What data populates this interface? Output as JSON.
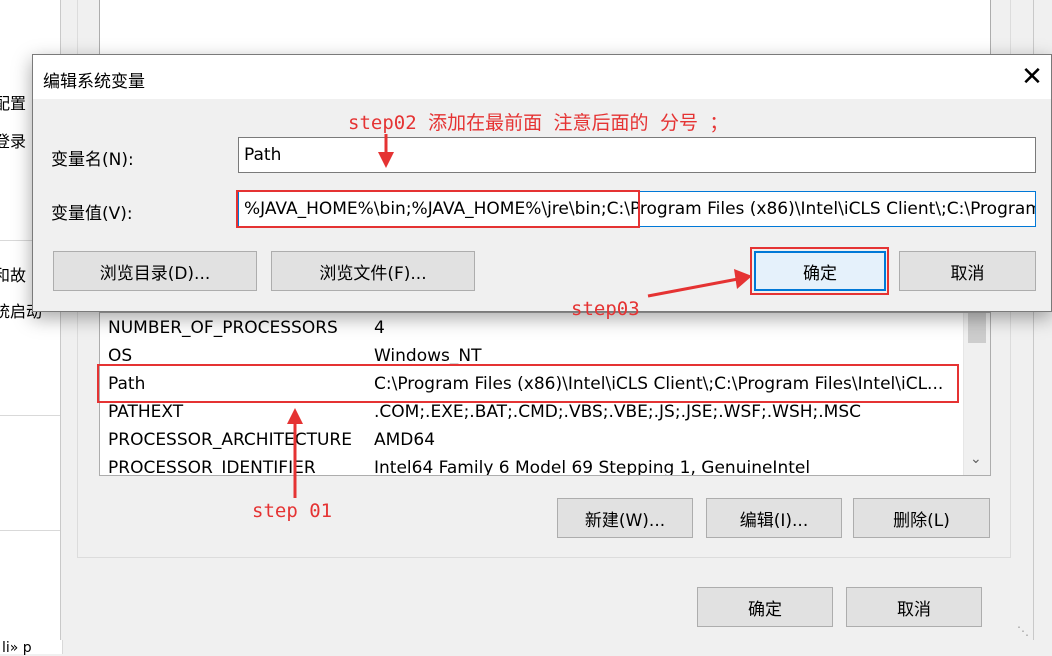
{
  "background": {
    "left_texts": [
      "配置",
      "登录",
      "和故",
      "统启动"
    ],
    "bottom_text": "li» p"
  },
  "variables": {
    "rows": [
      {
        "name": "NUMBER_OF_PROCESSORS",
        "value": "4"
      },
      {
        "name": "OS",
        "value": "Windows_NT"
      },
      {
        "name": "Path",
        "value": "C:\\Program Files (x86)\\Intel\\iCLS Client\\;C:\\Program Files\\Intel\\iCL..."
      },
      {
        "name": "PATHEXT",
        "value": ".COM;.EXE;.BAT;.CMD;.VBS;.VBE;.JS;.JSE;.WSF;.WSH;.MSC"
      },
      {
        "name": "PROCESSOR_ARCHITECTURE",
        "value": "AMD64"
      },
      {
        "name": "PROCESSOR_IDENTIFIER",
        "value": "Intel64 Family 6 Model 69 Stepping 1, GenuineIntel"
      }
    ],
    "new_button": "新建(W)...",
    "edit_button": "编辑(I)...",
    "delete_button": "删除(L)"
  },
  "window_footer": {
    "ok_label": "确定",
    "cancel_label": "取消"
  },
  "dialog": {
    "title": "编辑系统变量",
    "name_label": "变量名(N):",
    "name_value": "Path",
    "value_label": "变量值(V):",
    "value_value": "%JAVA_HOME%\\bin;%JAVA_HOME%\\jre\\bin;C:\\Program Files (x86)\\Intel\\iCLS Client\\;C:\\Program Files\\Intel\\iCLS Client\\",
    "browse_dir_label": "浏览目录(D)...",
    "browse_file_label": "浏览文件(F)...",
    "ok_label": "确定",
    "cancel_label": "取消"
  },
  "annotations": {
    "step01": "step 01",
    "step02": "step02 添加在最前面 注意后面的 分号 ；",
    "step03": "step03"
  },
  "colors": {
    "annotation_red": "#e53333",
    "focus_blue": "#0078d7"
  }
}
